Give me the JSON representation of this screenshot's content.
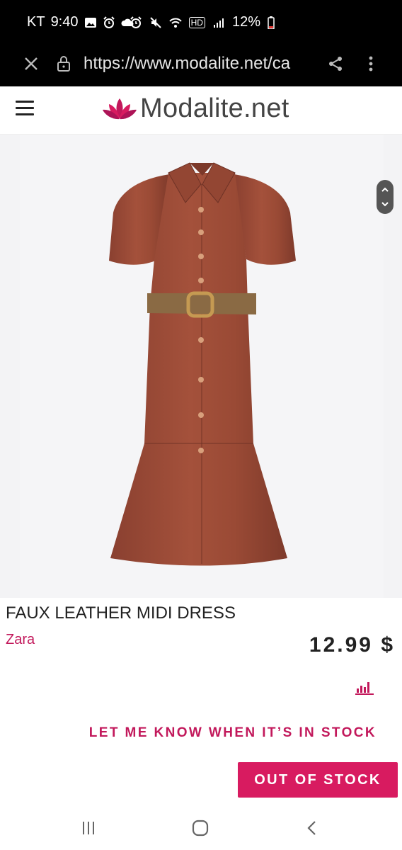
{
  "status_bar": {
    "carrier": "KT",
    "time": "9:40",
    "network_badge": "HD",
    "battery_percent": "12%",
    "icons": [
      "gallery-icon",
      "alarm-icon",
      "cloud-icon",
      "alarm-icon",
      "mute-icon",
      "wifi-icon",
      "signal-icon",
      "battery-icon"
    ]
  },
  "browser": {
    "url": "https://www.modalite.net/ca",
    "icons": [
      "close-icon",
      "lock-icon",
      "share-icon",
      "more-icon"
    ]
  },
  "site": {
    "logo_text": "Modalite.net",
    "brand_color": "#c2185b"
  },
  "product": {
    "title": "FAUX LEATHER MIDI DRESS",
    "brand": "Zara",
    "price": "12.99 $",
    "notify_label": "LET ME KNOW WHEN IT’S IN STOCK",
    "stock_button_label": "OUT OF STOCK",
    "accent_color": "#d81b60"
  },
  "nav": {
    "icons": [
      "recents-icon",
      "home-icon",
      "back-icon"
    ]
  }
}
